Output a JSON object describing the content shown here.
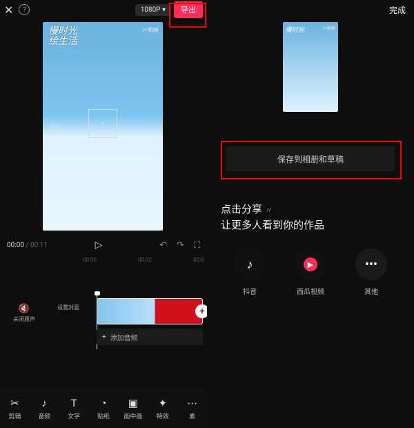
{
  "left": {
    "resolution": "1080P",
    "export_label": "导出",
    "preview": {
      "title": "慢时光\\n绘生活",
      "brand": "✂剪映",
      "marker": "1/250\\nOPEN\\nISO"
    },
    "time": {
      "current": "00:00",
      "total": "00:11"
    },
    "ruler": [
      "00:00",
      "00:02",
      "00:0"
    ],
    "side": {
      "mute": "关闭原声",
      "cover": "设置封面"
    },
    "audio_add": "添加音频",
    "toolbar": [
      {
        "icon": "✂",
        "label": "剪辑"
      },
      {
        "icon": "♪",
        "label": "音频"
      },
      {
        "icon": "T",
        "label": "文字"
      },
      {
        "icon": "◔",
        "label": "贴纸"
      },
      {
        "icon": "▣",
        "label": "画中画"
      },
      {
        "icon": "✦",
        "label": "特效"
      },
      {
        "icon": "⋯",
        "label": "素"
      }
    ]
  },
  "right": {
    "done": "完成",
    "thumb": {
      "title": "慢时光",
      "brand": "✂剪映"
    },
    "save_label": "保存到相册和草稿",
    "share": {
      "line1": "点击分享",
      "line2": "让更多人看到你的作品"
    },
    "targets": [
      {
        "name": "抖音",
        "kind": "douyin"
      },
      {
        "name": "西瓜视频",
        "kind": "xigua"
      },
      {
        "name": "其他",
        "kind": "other"
      }
    ]
  }
}
